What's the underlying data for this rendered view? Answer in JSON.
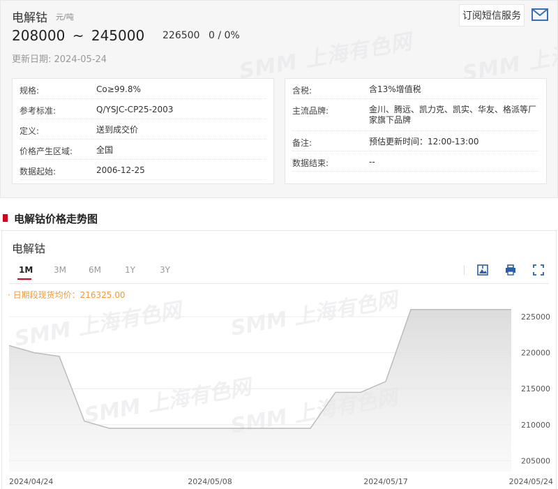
{
  "product": {
    "name": "电解钴",
    "unit": "元/吨"
  },
  "price": {
    "low": "208000",
    "sep": "~",
    "high": "245000",
    "avg": "226500",
    "change": "0 / 0%"
  },
  "update": "更新日期: 2024-05-24",
  "subscribe_label": "订阅短信服务",
  "watermark": "SMM 上海有色网",
  "left_rows": [
    {
      "k": "规格:",
      "v": "Co≥99.8%"
    },
    {
      "k": "参考标准:",
      "v": "Q/YSJC-CP25-2003"
    },
    {
      "k": "定义:",
      "v": "送到成交价"
    },
    {
      "k": "价格产生区域:",
      "v": "全国"
    },
    {
      "k": "数据起始:",
      "v": "2006-12-25"
    }
  ],
  "right_rows": [
    {
      "k": "含税:",
      "v": "含13%增值税"
    },
    {
      "k": "主流品牌:",
      "v": "金川、腾远、凯力克、凯实、华友、格派等厂家旗下品牌"
    },
    {
      "k": "备注:",
      "v": "预估更新时间：12:00-13:00"
    },
    {
      "k": "数据结束:",
      "v": "--"
    }
  ],
  "section_title": "电解钴价格走势图",
  "chart_title": "电解钴",
  "tabs": [
    "1M",
    "3M",
    "6M",
    "1Y",
    "3Y"
  ],
  "avg_label": "· 日期段现货均价：216325.00",
  "chart_data": {
    "type": "area",
    "x": [
      "2024/04/24",
      "2024/04/25",
      "2024/04/26",
      "2024/04/28",
      "2024/04/29",
      "2024/04/30",
      "2024/05/06",
      "2024/05/07",
      "2024/05/08",
      "2024/05/09",
      "2024/05/10",
      "2024/05/13",
      "2024/05/14",
      "2024/05/15",
      "2024/05/16",
      "2024/05/17",
      "2024/05/20",
      "2024/05/21",
      "2024/05/22",
      "2024/05/23",
      "2024/05/24"
    ],
    "values": [
      221000,
      220000,
      219500,
      210500,
      209500,
      209500,
      209500,
      209500,
      209500,
      209500,
      209500,
      209500,
      209500,
      214500,
      214500,
      216000,
      226000,
      226000,
      226000,
      226000,
      226000
    ],
    "x_ticks": [
      "2024/04/24",
      "2024/05/08",
      "2024/05/17",
      "2024/05/24"
    ],
    "y_ticks": [
      205000,
      210000,
      215000,
      220000,
      225000
    ],
    "ylim": [
      203500,
      228000
    ],
    "grid": true,
    "line_color": "#b8b8b8"
  }
}
